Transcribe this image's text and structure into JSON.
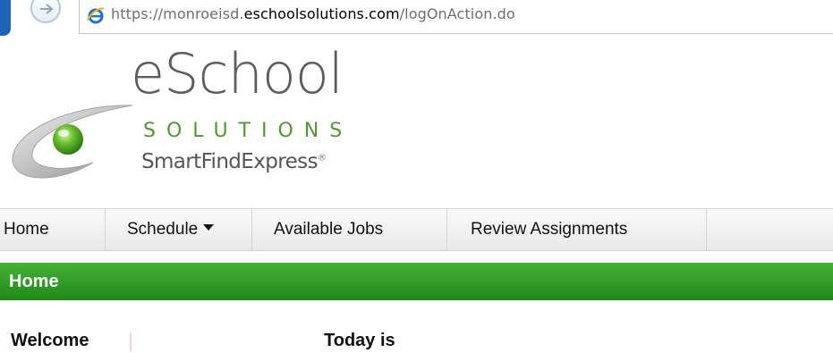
{
  "browser": {
    "url_prefix": "https://",
    "url_host_sub": "monroeisd.",
    "url_host_main": "eschoolsolutions.com",
    "url_path": "/logOnAction.do",
    "icons": {
      "back": "back-arrow-icon",
      "site": "internet-explorer-icon"
    }
  },
  "logo": {
    "brand": "eSchool",
    "tagline": "SOLUTIONS",
    "product": "SmartFindExpress",
    "mark": "®",
    "colors": {
      "green": "#4f9a2e",
      "gray": "#5d5d5d"
    }
  },
  "nav": {
    "home": "Home",
    "schedule": "Schedule",
    "available_jobs": "Available Jobs",
    "review_assignments": "Review Assignments"
  },
  "page": {
    "header": "Home",
    "header_color": "#2f9c25",
    "welcome": "Welcome",
    "today": "Today is"
  }
}
